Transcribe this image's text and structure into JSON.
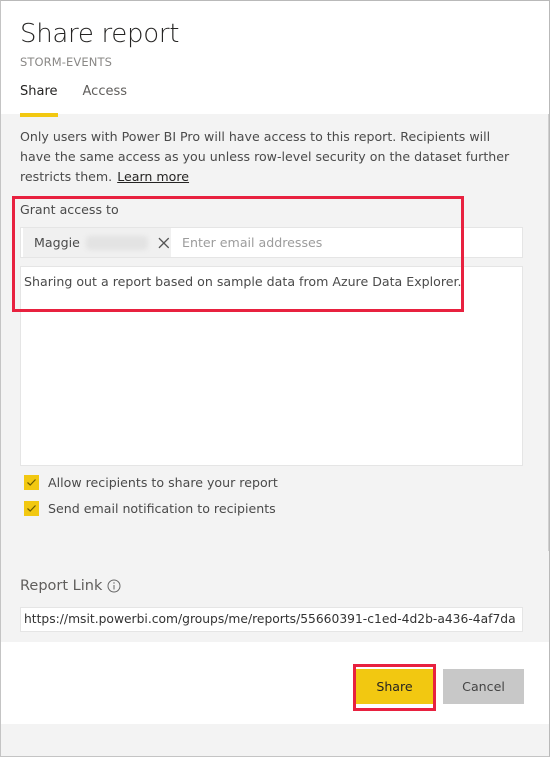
{
  "header": {
    "title": "Share report",
    "subtitle": "STORM-EVENTS",
    "tabs": [
      {
        "label": "Share",
        "active": true
      },
      {
        "label": "Access",
        "active": false
      }
    ]
  },
  "notice": {
    "text": "Only users with Power BI Pro will have access to this report. Recipients will have the same access as you unless row-level security on the dataset further restricts them.",
    "link_label": "Learn more"
  },
  "grant": {
    "label": "Grant access to",
    "recipients": [
      {
        "name": "Maggie",
        "surname_redacted": true
      }
    ],
    "email_placeholder": "Enter email addresses",
    "message": "Sharing out a report based on sample data from Azure Data Explorer."
  },
  "options": [
    {
      "label": "Allow recipients to share your report",
      "checked": true
    },
    {
      "label": "Send email notification to recipients",
      "checked": true
    }
  ],
  "report_link": {
    "label": "Report Link",
    "icon": "info-icon",
    "url": "https://msit.powerbi.com/groups/me/reports/55660391-c1ed-4d2b-a436-4af7da"
  },
  "footer": {
    "share_label": "Share",
    "cancel_label": "Cancel"
  },
  "colors": {
    "accent": "#f2c811",
    "highlight": "#e8213f",
    "panel_background": "#f3f3f3",
    "cancel_background": "#c8c8c8"
  }
}
